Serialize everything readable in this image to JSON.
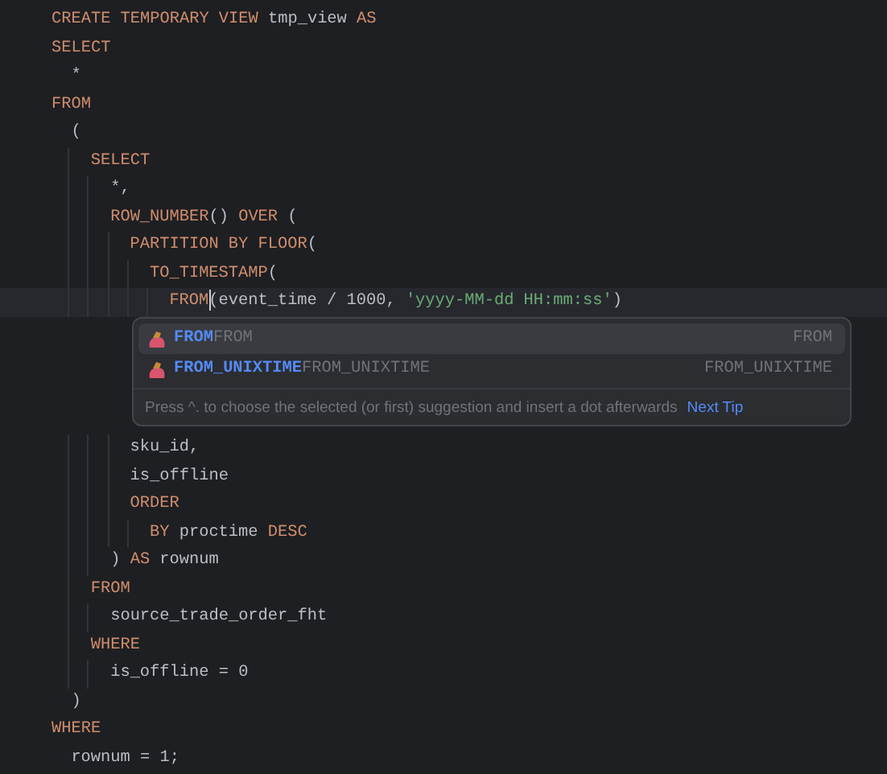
{
  "editor": {
    "lines": [
      {
        "current": false,
        "tokens": [
          {
            "text": "CREATE TEMPORARY VIEW",
            "kind": "keyword"
          },
          {
            "text": " tmp_view ",
            "kind": "ident"
          },
          {
            "text": "AS",
            "kind": "keyword"
          }
        ]
      },
      {
        "current": false,
        "tokens": [
          {
            "text": "SELECT",
            "kind": "keyword"
          }
        ]
      },
      {
        "current": false,
        "tokens": [
          {
            "text": "  *",
            "kind": "ident"
          }
        ]
      },
      {
        "current": false,
        "tokens": [
          {
            "text": "FROM",
            "kind": "keyword"
          }
        ]
      },
      {
        "current": false,
        "tokens": [
          {
            "text": "  (",
            "kind": "ident"
          }
        ]
      },
      {
        "current": false,
        "tokens": [
          {
            "text": "    SELECT",
            "kind": "keyword"
          }
        ]
      },
      {
        "current": false,
        "tokens": [
          {
            "text": "      *,",
            "kind": "ident"
          }
        ]
      },
      {
        "current": false,
        "tokens": [
          {
            "text": "      ROW_NUMBER",
            "kind": "keyword"
          },
          {
            "text": "() ",
            "kind": "ident"
          },
          {
            "text": "OVER",
            "kind": "keyword"
          },
          {
            "text": " (",
            "kind": "ident"
          }
        ]
      },
      {
        "current": false,
        "tokens": [
          {
            "text": "        PARTITION BY FLOOR",
            "kind": "keyword"
          },
          {
            "text": "(",
            "kind": "ident"
          }
        ]
      },
      {
        "current": false,
        "tokens": [
          {
            "text": "          TO_TIMESTAMP",
            "kind": "keyword"
          },
          {
            "text": "(",
            "kind": "ident"
          }
        ]
      },
      {
        "current": true,
        "tokens": [
          {
            "text": "            FROM",
            "kind": "keyword",
            "caret": true
          },
          {
            "text": "(event_time / 1000, ",
            "kind": "ident"
          },
          {
            "text": "'yyyy-MM-dd HH:mm:ss'",
            "kind": "string"
          },
          {
            "text": ")",
            "kind": "ident"
          }
        ]
      },
      {
        "current": false,
        "tokens": [
          {
            "text": "        sku_id,",
            "kind": "ident"
          }
        ]
      },
      {
        "current": false,
        "tokens": [
          {
            "text": "        is_offline",
            "kind": "ident"
          }
        ]
      },
      {
        "current": false,
        "tokens": [
          {
            "text": "        ORDER",
            "kind": "keyword"
          }
        ]
      },
      {
        "current": false,
        "tokens": [
          {
            "text": "          BY",
            "kind": "keyword"
          },
          {
            "text": " proctime ",
            "kind": "ident"
          },
          {
            "text": "DESC",
            "kind": "keyword"
          }
        ]
      },
      {
        "current": false,
        "tokens": [
          {
            "text": "      ) ",
            "kind": "ident"
          },
          {
            "text": "AS",
            "kind": "keyword"
          },
          {
            "text": " rownum",
            "kind": "ident"
          }
        ]
      },
      {
        "current": false,
        "tokens": [
          {
            "text": "    FROM",
            "kind": "keyword"
          }
        ]
      },
      {
        "current": false,
        "tokens": [
          {
            "text": "      source_trade_order_fht",
            "kind": "ident"
          }
        ]
      },
      {
        "current": false,
        "tokens": [
          {
            "text": "    WHERE",
            "kind": "keyword"
          }
        ]
      },
      {
        "current": false,
        "tokens": [
          {
            "text": "      is_offline = 0",
            "kind": "ident"
          }
        ]
      },
      {
        "current": false,
        "tokens": [
          {
            "text": "  )",
            "kind": "ident"
          }
        ]
      },
      {
        "current": false,
        "tokens": [
          {
            "text": "WHERE",
            "kind": "keyword"
          }
        ]
      },
      {
        "current": false,
        "tokens": [
          {
            "text": "  rownum = 1;",
            "kind": "ident"
          }
        ]
      }
    ]
  },
  "completion": {
    "items": [
      {
        "name": "FROM",
        "detail": "FROM",
        "type": "FROM",
        "selected": true
      },
      {
        "name": "FROM_UNIXTIME",
        "detail": "FROM_UNIXTIME",
        "type": "FROM_UNIXTIME",
        "selected": false
      }
    ],
    "hint": "Press ^. to choose the selected (or first) suggestion and insert a dot afterwards",
    "hint_link": "Next Tip"
  }
}
